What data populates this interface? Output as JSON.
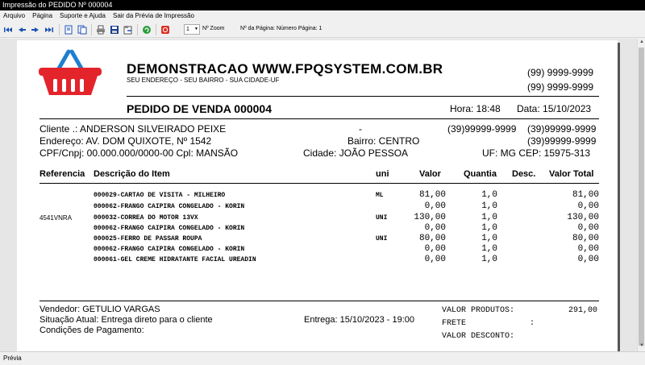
{
  "window": {
    "title": "Impressão do PEDIDO Nº 000004"
  },
  "menu": [
    "Arquivo",
    "Página",
    "Suporte e Ajuda",
    "Sair da Prévia de Impressão"
  ],
  "toolbar": {
    "zoom_value": "1",
    "zoom_label": "Nº Zoom",
    "page_label": "Nº da Página: Número Página: 1"
  },
  "status": {
    "text": "Prévia"
  },
  "doc": {
    "company": "DEMONSTRACAO WWW.FPQSYSTEM.COM.BR",
    "address": "SEU ENDEREÇO - SEU BAIRRO - SUA CIDADE-UF",
    "phone1": "(99) 9999-9999",
    "phone2": "(99) 9999-9999",
    "title": "PEDIDO DE VENDA 000004",
    "hora": "Hora: 18:48",
    "data": "Data: 15/10/2023",
    "cliente": "Cliente   .: ANDERSON SILVEIRADO PEIXE",
    "dash": "-",
    "cli_phone1": "(39)99999-9999",
    "cli_phone2": "(39)99999-9999",
    "endereco": "Endereço: AV. DOM QUIXOTE, Nº 1542",
    "bairro": "Bairro: CENTRO",
    "cli_phone3": "(39)99999-9999",
    "cpf": "CPF/Cnpj: 00.000.000/0000-00 Cpl: MANSÃO",
    "cidade": "Cidade: JOÃO PESSOA",
    "ufcep": "UF: MG CEP: 15975-313",
    "headers": {
      "referencia": "Referencia",
      "descricao": "Descrição do Item",
      "uni": "uni",
      "valor": "Valor",
      "quantia": "Quantia",
      "desc": "Desc.",
      "total": "Valor Total"
    },
    "items": [
      {
        "ref": "",
        "desc": "000029-CARTAO DE VISITA - MILHEIRO",
        "uni": "ML",
        "valor": "81,00",
        "qtd": "1,0",
        "total": "81,00"
      },
      {
        "ref": "",
        "desc": "000062-FRANGO CAIPIRA CONGELADO - KORIN",
        "uni": "",
        "valor": "0,00",
        "qtd": "1,0",
        "total": "0,00"
      },
      {
        "ref": "4541VNRA",
        "desc": "000032-CORREA DO MOTOR 13VX",
        "uni": "UNI",
        "valor": "130,00",
        "qtd": "1,0",
        "total": "130,00"
      },
      {
        "ref": "",
        "desc": "000062-FRANGO CAIPIRA CONGELADO - KORIN",
        "uni": "",
        "valor": "0,00",
        "qtd": "1,0",
        "total": "0,00"
      },
      {
        "ref": "",
        "desc": "000025-FERRO DE PASSAR ROUPA",
        "uni": "UNI",
        "valor": "80,00",
        "qtd": "1,0",
        "total": "80,00"
      },
      {
        "ref": "",
        "desc": "000062-FRANGO CAIPIRA CONGELADO - KORIN",
        "uni": "",
        "valor": "0,00",
        "qtd": "1,0",
        "total": "0,00"
      },
      {
        "ref": "",
        "desc": "000061-GEL CREME HIDRATANTE FACIAL UREADIN",
        "uni": "",
        "valor": "0,00",
        "qtd": "1,0",
        "total": "0,00"
      }
    ],
    "vendedor": "Vendedor: GETULIO VARGAS",
    "situacao": "Situação Atual: Entrega direto para o cliente",
    "entrega": "Entrega: 15/10/2023 - 19:00",
    "condicoes": "Condições de Pagamento:",
    "valor_produtos_label": "VALOR PRODUTOS:",
    "valor_produtos": "291,00",
    "frete_label": "FRETE",
    "frete_colon": ":",
    "desconto_label": "VALOR DESCONTO:"
  },
  "colors": {
    "basket": "#e3242b",
    "basket_handle": "#1e7fd0",
    "titlebar": "#000000"
  }
}
